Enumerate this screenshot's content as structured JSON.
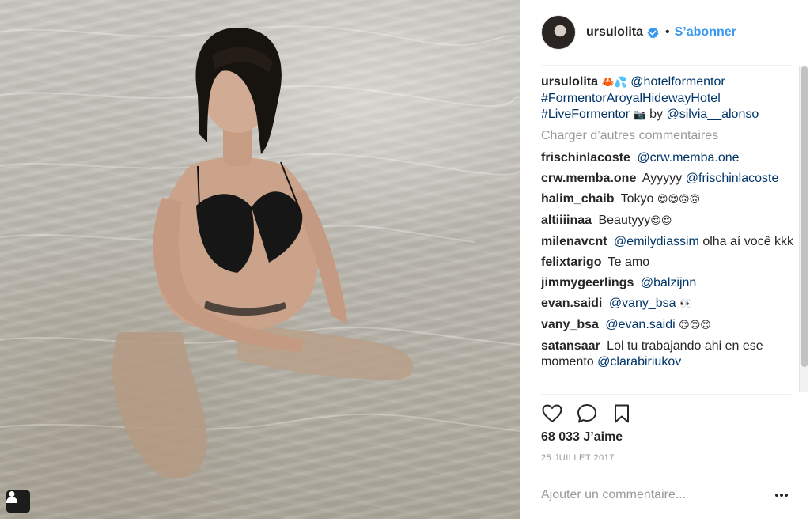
{
  "post": {
    "image_alt": "Photo",
    "profile_icon": "person-icon"
  },
  "header": {
    "username": "ursulolita",
    "verified_icon": "verified-badge-icon",
    "separator": "•",
    "follow_label": "S’abonner"
  },
  "caption": {
    "username": "ursulolita",
    "emojis": "🦀💦",
    "mention1": "@hotelformentor",
    "tag1": "#FormentorAroyalHidewayHotel",
    "tag2": "#LiveFormentor",
    "emoji2": "📷",
    "by": "by",
    "mention2": "@silvia__alonso"
  },
  "load_more": "Charger d’autres commentaires",
  "comments": [
    {
      "user": "frischinlacoste",
      "mention": "@crw.memba.one",
      "text": ""
    },
    {
      "user": "crw.memba.one",
      "text": "Ayyyyy",
      "mention": "@frischinlacoste"
    },
    {
      "user": "halim_chaib",
      "text": "Tokyo",
      "emoji": "😍😍🙃🙃"
    },
    {
      "user": "altiiiinaa",
      "text": "Beautyyy",
      "emoji": "😍😍"
    },
    {
      "user": "milenavcnt",
      "mention": "@emilydiassim",
      "text": "olha aí você kkk"
    },
    {
      "user": "felixtarigo",
      "text": "Te amo"
    },
    {
      "user": "jimmygeerlings",
      "mention": "@balzijnn"
    },
    {
      "user": "evan.saidi",
      "mention": "@vany_bsa",
      "emoji": "👀"
    },
    {
      "user": "vany_bsa",
      "mention": "@evan.saidi",
      "emoji": "😍😍😍"
    },
    {
      "user": "satansaar",
      "text": "Lol tu trabajando ahi en ese momento",
      "mention": "@clarabiriukov"
    }
  ],
  "actions": {
    "like_icon": "heart-icon",
    "comment_icon": "comment-icon",
    "save_icon": "bookmark-icon"
  },
  "likes": "68 033 J’aime",
  "date": "25 JUILLET 2017",
  "add_comment": {
    "placeholder": "Ajouter un commentaire...",
    "more_icon": "more-options-icon"
  }
}
